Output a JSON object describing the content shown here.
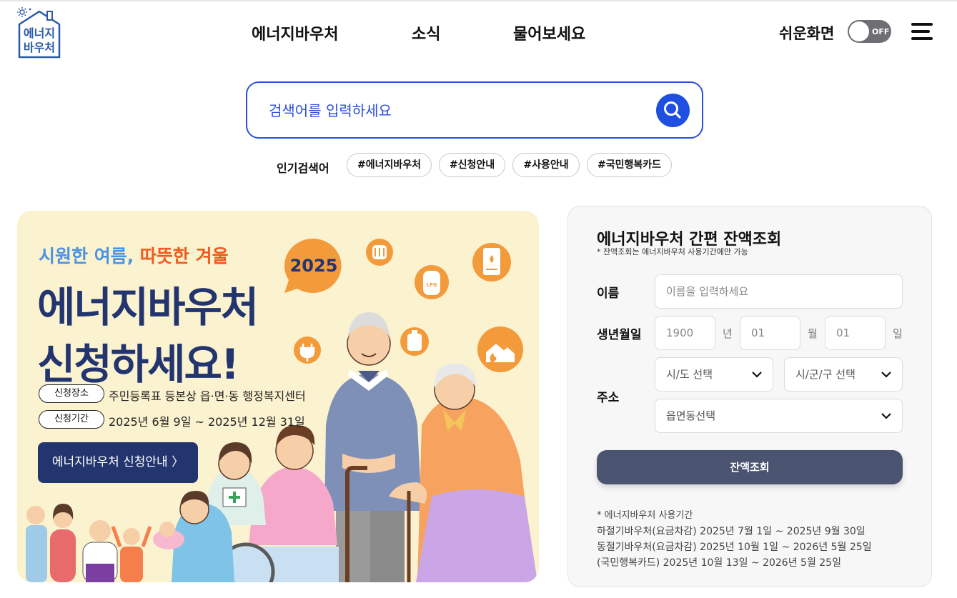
{
  "header": {
    "logo_text": [
      "에너지",
      "바우처"
    ],
    "nav": [
      "에너지바우처",
      "소식",
      "물어보세요"
    ],
    "easy_view_label": "쉬운화면",
    "toggle_state": "OFF",
    "icons": {
      "menu": "hamburger-menu-icon"
    }
  },
  "search": {
    "placeholder": "검색어를 입력하세요",
    "icon": "search-icon",
    "popular_label": "인기검색어",
    "tags": [
      "#에너지바우처",
      "#신청안내",
      "#사용안내",
      "#국민행복카드"
    ]
  },
  "banner": {
    "subtitle_part1": "시원한 여름,",
    "subtitle_part2": "따뜻한 겨울",
    "badge_year": "2025",
    "title_line1": "에너지바우처",
    "title_line2": "신청하세요!",
    "place_label": "신청장소",
    "place_text": "주민등록표 등본상 읍·면·동 행정복지센터",
    "period_label": "신청기간",
    "period_text": "2025년 6월 9일 ~ 2025년 12월 31일",
    "button_label": "에너지바우처 신청안내 〉",
    "lpg_label": "LPG"
  },
  "balance": {
    "title": "에너지바우처 간편 잔액조회",
    "note": "* 잔액조회는 에너지바우처 사용기간에만 가능",
    "name_label": "이름",
    "name_placeholder": "이름을 입력하세요",
    "birth_label": "생년월일",
    "birth_year": "1900",
    "birth_year_unit": "년",
    "birth_month": "01",
    "birth_month_unit": "월",
    "birth_day": "01",
    "birth_day_unit": "일",
    "address_label": "주소",
    "sido_select": "시/도 선택",
    "sigungu_select": "시/군/구 선택",
    "eupmyeondong_select": "읍면동선택",
    "submit_label": "잔액조회",
    "period_title": "* 에너지바우처 사용기간",
    "period_lines": [
      "하절기바우처(요금차감) 2025년 7월 1일 ~ 2025년 9월 30일",
      "동절기바우처(요금차감) 2025년 10월 1일 ~ 2026년 5월 25일",
      "(국민행복카드) 2025년 10월 13일 ~ 2026년 5월 25일"
    ]
  },
  "colors": {
    "accent_blue": "#1f4fe0",
    "banner_bg": "#fbf2cf",
    "banner_navy": "#22356f",
    "submit_bg": "#4a5470",
    "orange": "#ef5a1d"
  }
}
